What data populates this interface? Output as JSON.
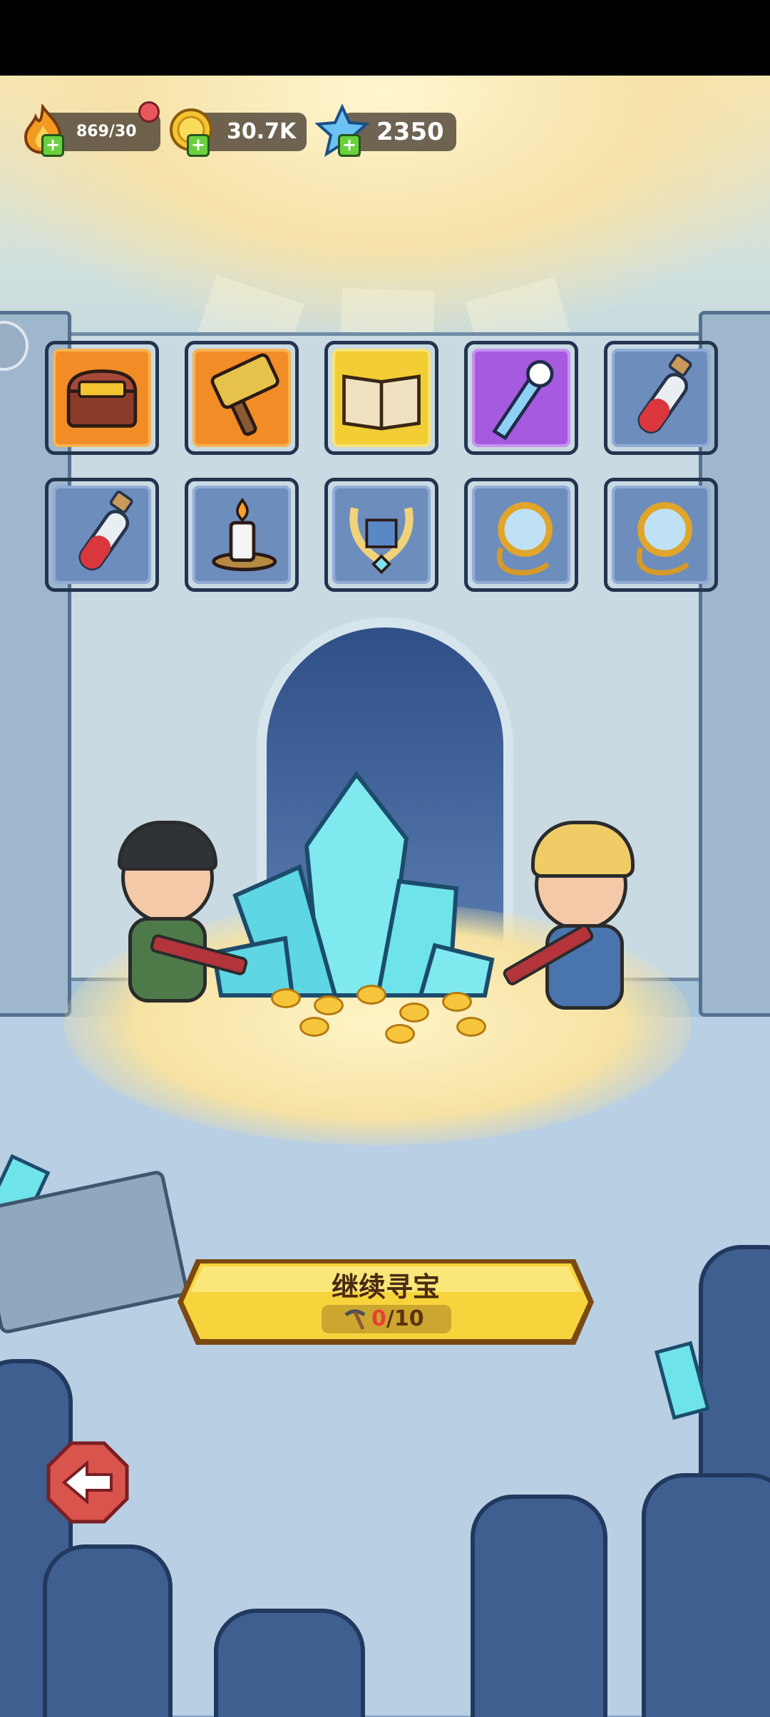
{
  "resources": {
    "energy": {
      "value": "869/30",
      "icon": "flame-icon"
    },
    "coins": {
      "value": "30.7K",
      "icon": "coin-icon"
    },
    "gems": {
      "value": "2350",
      "icon": "crystal-icon"
    }
  },
  "reward_items": [
    {
      "name": "treasure-chest",
      "rarity": "orange"
    },
    {
      "name": "hammer",
      "rarity": "orange"
    },
    {
      "name": "spell-book",
      "rarity": "yellow"
    },
    {
      "name": "ice-sword",
      "rarity": "purple"
    },
    {
      "name": "red-potion",
      "rarity": "blue"
    },
    {
      "name": "red-potion",
      "rarity": "blue"
    },
    {
      "name": "candle",
      "rarity": "blue"
    },
    {
      "name": "lyre",
      "rarity": "blue"
    },
    {
      "name": "magnifier-mirror",
      "rarity": "blue"
    },
    {
      "name": "magnifier-mirror",
      "rarity": "blue"
    }
  ],
  "main_action": {
    "label": "继续寻宝",
    "progress_current": "0",
    "progress_total": "/10",
    "icon": "pickaxe-icon"
  },
  "back_button": {
    "icon": "back-arrow-icon"
  },
  "colors": {
    "button_yellow": "#f7d43c",
    "rarity_orange": "#f28c27",
    "rarity_yellow": "#f2cd34",
    "rarity_purple": "#a55ae0",
    "rarity_blue": "#6d8dbd"
  }
}
